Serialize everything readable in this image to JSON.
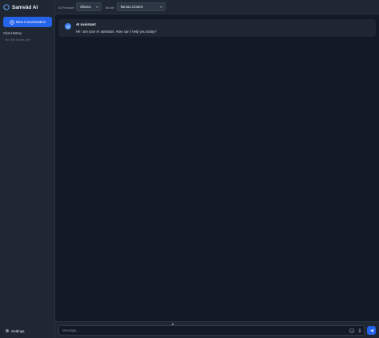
{
  "app": {
    "title": "Samvād AI",
    "accent_color": "#2563eb"
  },
  "sidebar": {
    "new_conversation_label": "New Conversation",
    "history_label": "Chat History",
    "history_empty": "No chat history yet",
    "settings_label": "Settings"
  },
  "topbar": {
    "provider_label": "AI Provider",
    "provider_value": "Ollama",
    "model_label": "Model",
    "model_value": "llama3.2:latest"
  },
  "messages": [
    {
      "author": "AI Assistant",
      "text": "Hi! I am your AI assistant. How can I help you today?"
    }
  ],
  "composer": {
    "placeholder": "Message..."
  }
}
